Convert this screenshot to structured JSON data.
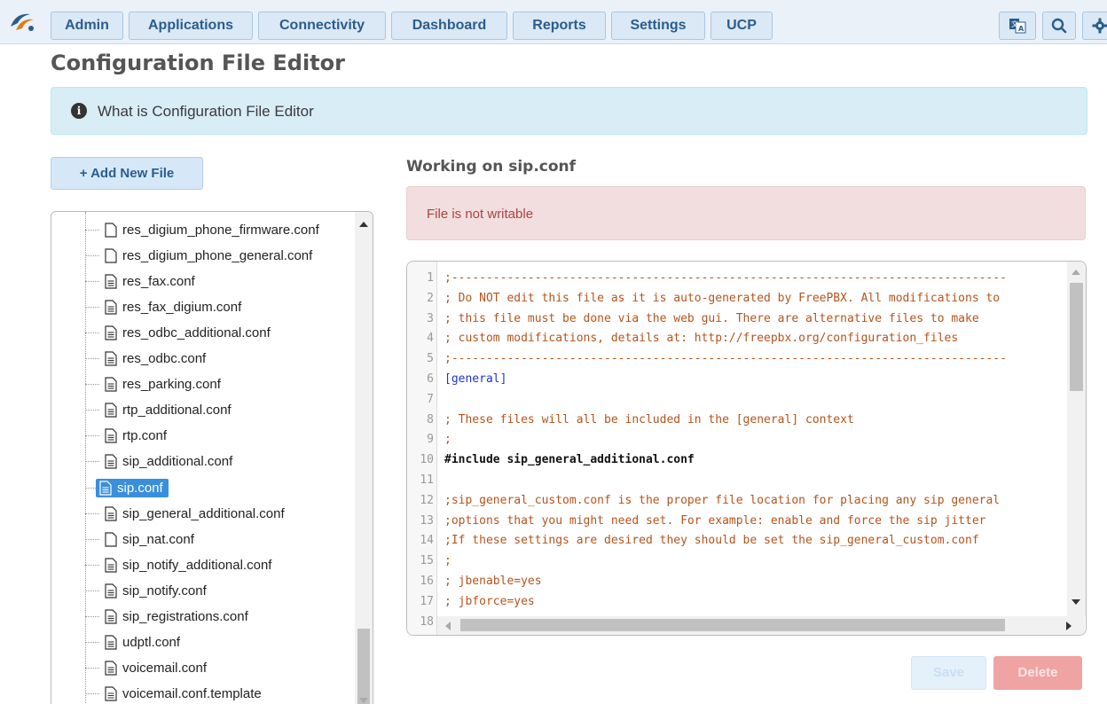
{
  "nav": {
    "items": [
      "Admin",
      "Applications",
      "Connectivity",
      "Dashboard",
      "Reports",
      "Settings",
      "UCP"
    ]
  },
  "page": {
    "title": "Configuration File Editor",
    "info_text": "What is Configuration File Editor",
    "add_button": "Add New File",
    "working_on": "Working on sip.conf",
    "alert": "File is not writable",
    "save_label": "Save",
    "delete_label": "Delete"
  },
  "tree": {
    "items": [
      {
        "label": "res_digium_phone_firmware.conf",
        "icon": "file-outline-icon"
      },
      {
        "label": "res_digium_phone_general.conf",
        "icon": "file-outline-icon"
      },
      {
        "label": "res_fax.conf",
        "icon": "file-text-icon"
      },
      {
        "label": "res_fax_digium.conf",
        "icon": "file-text-icon"
      },
      {
        "label": "res_odbc_additional.conf",
        "icon": "file-text-icon"
      },
      {
        "label": "res_odbc.conf",
        "icon": "file-text-icon"
      },
      {
        "label": "res_parking.conf",
        "icon": "file-text-icon"
      },
      {
        "label": "rtp_additional.conf",
        "icon": "file-text-icon"
      },
      {
        "label": "rtp.conf",
        "icon": "file-text-icon"
      },
      {
        "label": "sip_additional.conf",
        "icon": "file-text-icon"
      },
      {
        "label": "sip.conf",
        "icon": "file-text-icon",
        "selected": true
      },
      {
        "label": "sip_general_additional.conf",
        "icon": "file-text-icon"
      },
      {
        "label": "sip_nat.conf",
        "icon": "file-outline-icon"
      },
      {
        "label": "sip_notify_additional.conf",
        "icon": "file-text-icon"
      },
      {
        "label": "sip_notify.conf",
        "icon": "file-text-icon"
      },
      {
        "label": "sip_registrations.conf",
        "icon": "file-text-icon"
      },
      {
        "label": "udptl.conf",
        "icon": "file-text-icon"
      },
      {
        "label": "voicemail.conf",
        "icon": "file-text-icon"
      },
      {
        "label": "voicemail.conf.template",
        "icon": "file-text-icon"
      }
    ]
  },
  "editor": {
    "lines": [
      {
        "n": "1",
        "text": ";--------------------------------------------------------------------------------",
        "type": "comment"
      },
      {
        "n": "2",
        "text": "; Do NOT edit this file as it is auto-generated by FreePBX. All modifications to",
        "type": "comment"
      },
      {
        "n": "3",
        "text": "; this file must be done via the web gui. There are alternative files to make",
        "type": "comment"
      },
      {
        "n": "4",
        "text": "; custom modifications, details at: http://freepbx.org/configuration_files",
        "type": "comment"
      },
      {
        "n": "5",
        "text": ";--------------------------------------------------------------------------------",
        "type": "comment"
      },
      {
        "n": "6",
        "text": "[general]",
        "type": "section"
      },
      {
        "n": "7",
        "text": "",
        "type": "plain"
      },
      {
        "n": "8",
        "text": "; These files will all be included in the [general] context",
        "type": "comment"
      },
      {
        "n": "9",
        "text": ";",
        "type": "comment"
      },
      {
        "n": "10",
        "text": "#include sip_general_additional.conf",
        "type": "include"
      },
      {
        "n": "11",
        "text": "",
        "type": "plain"
      },
      {
        "n": "12",
        "text": ";sip_general_custom.conf is the proper file location for placing any sip general",
        "type": "comment"
      },
      {
        "n": "13",
        "text": ";options that you might need set. For example: enable and force the sip jitter",
        "type": "comment"
      },
      {
        "n": "14",
        "text": ";If these settings are desired they should be set the sip_general_custom.conf",
        "type": "comment"
      },
      {
        "n": "15",
        "text": ";",
        "type": "comment"
      },
      {
        "n": "16",
        "text": "; jbenable=yes",
        "type": "comment"
      },
      {
        "n": "17",
        "text": "; jbforce=yes",
        "type": "comment"
      },
      {
        "n": "18",
        "text": "",
        "type": "plain"
      }
    ]
  }
}
